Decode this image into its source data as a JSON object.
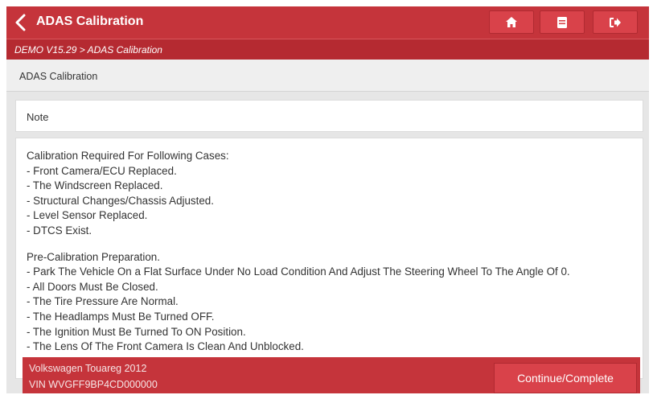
{
  "header": {
    "title": "ADAS Calibration",
    "icons": [
      "back-chevron-icon",
      "home-icon",
      "print-icon",
      "exit-icon"
    ]
  },
  "breadcrumb": "DEMO V15.29 > ADAS Calibration",
  "section_title": "ADAS Calibration",
  "note_label": "Note",
  "content_lines": [
    "Calibration Required For Following Cases:",
    " - Front Camera/ECU Replaced.",
    " - The Windscreen Replaced.",
    " - Structural Changes/Chassis Adjusted.",
    " - Level Sensor Replaced.",
    " - DTCS Exist.",
    "",
    "Pre-Calibration Preparation.",
    " - Park The Vehicle On a Flat Surface Under No Load Condition And Adjust The Steering Wheel To The Angle Of 0.",
    " - All Doors Must Be Closed.",
    " - The Tire Pressure Are Normal.",
    " - The Headlamps Must Be Turned OFF.",
    " - The Ignition Must Be Turned To ON Position.",
    " - The Lens Of The Front Camera Is Clean And Unblocked."
  ],
  "footer": {
    "vehicle": "Volkswagen Touareg 2012",
    "vin": "VIN WVGFF9BP4CD000000",
    "continue_label": "Continue/Complete"
  },
  "colors": {
    "primary_red": "#c5343b",
    "breadcrumb_red": "#b52a31",
    "button_red": "#d9424a"
  }
}
